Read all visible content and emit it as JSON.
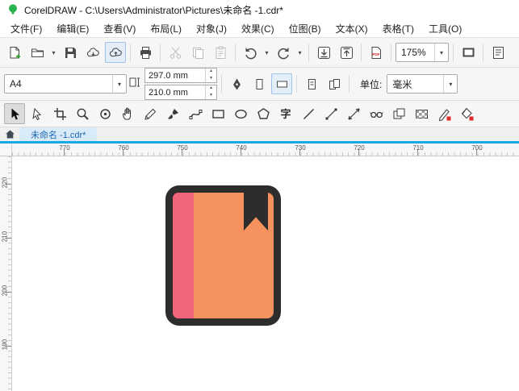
{
  "titlebar": {
    "title": "CorelDRAW - C:\\Users\\Administrator\\Pictures\\未命名 -1.cdr*"
  },
  "menubar": {
    "items": [
      "文件(F)",
      "编辑(E)",
      "查看(V)",
      "布局(L)",
      "对象(J)",
      "效果(C)",
      "位图(B)",
      "文本(X)",
      "表格(T)",
      "工具(O)"
    ]
  },
  "standard_toolbar": {
    "zoom_level": "175%",
    "pdf_label": "PDF"
  },
  "property_bar": {
    "page_size": "A4",
    "page_width": "297.0 mm",
    "page_height": "210.0 mm",
    "units_label": "单位:",
    "units_value": "毫米"
  },
  "tab_bar": {
    "active_tab": "未命名 -1.cdr*"
  },
  "rulers": {
    "horizontal": [
      "770",
      "760",
      "750",
      "740",
      "730",
      "720",
      "710",
      "700"
    ],
    "vertical": [
      "220",
      "210",
      "200",
      "190"
    ]
  },
  "toolbox": {
    "active_tool": "pick",
    "text_tool_glyph": "字",
    "tools": [
      "pick",
      "shape",
      "crop",
      "zoom",
      "smooth",
      "pan",
      "freehand",
      "artistic-media",
      "bezier",
      "rectangle",
      "ellipse",
      "polygon",
      "text",
      "line",
      "connector",
      "dimension",
      "blend",
      "container",
      "transparency",
      "outline-pen",
      "smart-fill"
    ]
  },
  "canvas": {
    "book": {
      "body_color": "#f6925e",
      "spine_color": "#f2647a",
      "outline_color": "#2d2d2d"
    }
  },
  "colors": {
    "accent_blue": "#18a8e8",
    "tab_bg": "#d9eaf9",
    "tab_text": "#1a66b0"
  }
}
